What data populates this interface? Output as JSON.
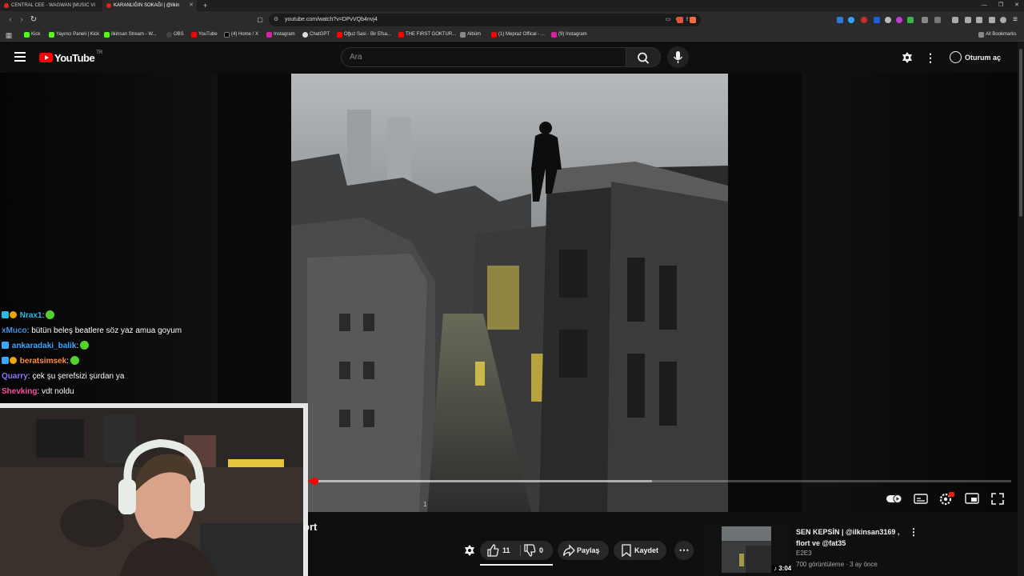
{
  "browser": {
    "tabs": [
      {
        "label": "CENTRAL CEE - WAGWAN [MUSIC VI",
        "active": false
      },
      {
        "label": "KARANLIĞIN SOKAĞI | @ilkin",
        "active": true
      }
    ],
    "new_tab": "+",
    "url": "youtube.com/watch?v=DPvVQb4nvj4",
    "bookmarks": [
      {
        "label": "Kick",
        "color": "#53fc18"
      },
      {
        "label": "Yayıncı Paneli | Kick",
        "color": "#53fc18"
      },
      {
        "label": "ilkinsan Stream - W...",
        "color": "#53fc18"
      },
      {
        "label": "OBS",
        "color": "#444444"
      },
      {
        "label": "YouTube",
        "color": "#ff0000"
      },
      {
        "label": "(4) Home / X",
        "color": "#000000"
      },
      {
        "label": "Instagram",
        "color": "#d6249f"
      },
      {
        "label": "ChatGPT",
        "color": "#dddddd"
      },
      {
        "label": "Oğuz Sasi - Bir Efsa...",
        "color": "#ff0000"
      },
      {
        "label": "THE FIRST GOKTUR...",
        "color": "#ff0000"
      },
      {
        "label": "Albüm",
        "color": "#888888"
      },
      {
        "label": "(1) Mepraz Offical - ...",
        "color": "#ff0000"
      },
      {
        "label": "(9) Instagram",
        "color": "#d6249f"
      }
    ],
    "all_bookmarks": "All Bookmarks"
  },
  "youtube": {
    "logo_text": "YouTube",
    "country_code": "TR",
    "search_placeholder": "Ara",
    "signin_label": "Oturum aç"
  },
  "chat": [
    {
      "user": "Nrax1",
      "user_color": "#2db9e6",
      "sep": ":",
      "message": "",
      "emote": true,
      "badges": [
        "#2db9e6",
        "#f0a500"
      ]
    },
    {
      "user": "xMuco",
      "user_color": "#4a90e2",
      "sep": ":",
      "message": " bütün beleş beatlere söz yaz amua goyum",
      "emote": false,
      "badges": []
    },
    {
      "user": "ankaradaki_balik",
      "user_color": "#3aa8ff",
      "sep": ":",
      "message": "",
      "emote": true,
      "badges": [
        "#3aa8ff"
      ]
    },
    {
      "user": "beratsimsek",
      "user_color": "#ff8a3d",
      "sep": ":",
      "message": "",
      "emote": true,
      "badges": [
        "#3aa8ff",
        "#f0a500"
      ]
    },
    {
      "user": "Quarry",
      "user_color": "#8a7dff",
      "sep": ":",
      "message": " çek şu şerefsizi şurdan ya",
      "emote": false,
      "badges": []
    },
    {
      "user": "Shevking",
      "user_color": "#ff4da6",
      "sep": ":",
      "message": " vdt noldu",
      "emote": false,
      "badges": []
    }
  ],
  "player": {
    "progress_fraction": 0.01,
    "buffer_fraction": 0.49,
    "time_label": "1"
  },
  "video": {
    "title_fragment": "ort",
    "actions": {
      "like_count": "11",
      "dislike_count": "0",
      "share_label": "Paylaş",
      "save_label": "Kaydet"
    }
  },
  "recommendation": {
    "title": "SEN KEPSİN | @ilkinsan3169 , flort ve @fat35",
    "channel": "E2E3",
    "meta": "700 görüntüleme · 3 ay önce",
    "duration": "3:04"
  },
  "colors": {
    "accent": "#ff0000",
    "background": "#0f0f0f",
    "pill": "#272727"
  }
}
